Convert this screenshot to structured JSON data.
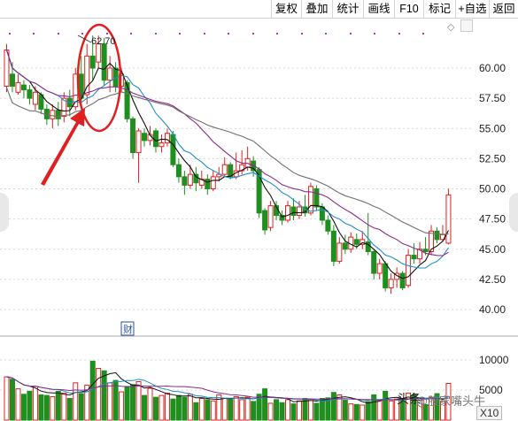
{
  "toolbar": {
    "buttons": [
      "复权",
      "叠加",
      "统计",
      "画线",
      "F10",
      "标记",
      "+自选",
      "返回"
    ]
  },
  "chart": {
    "high_label": "62.70",
    "price_ticks": [
      "60.00",
      "57.50",
      "55.00",
      "52.50",
      "50.00",
      "47.50",
      "45.00",
      "42.50",
      "40.00"
    ],
    "volume_ticks": [
      "10000",
      "5000"
    ],
    "volume_unit": "X10",
    "event_marker": "财",
    "colors": {
      "up": "#e02020",
      "down": "#1f8f1f",
      "ma5": "#111111",
      "ma10": "#1e90c8",
      "ma20": "#8a2a8a",
      "ma60": "#707070",
      "annotation": "#e02020",
      "dots": "#c030c0"
    }
  },
  "watermark": {
    "prefix": "头条",
    "handle": "@股家嘴头牛"
  }
}
